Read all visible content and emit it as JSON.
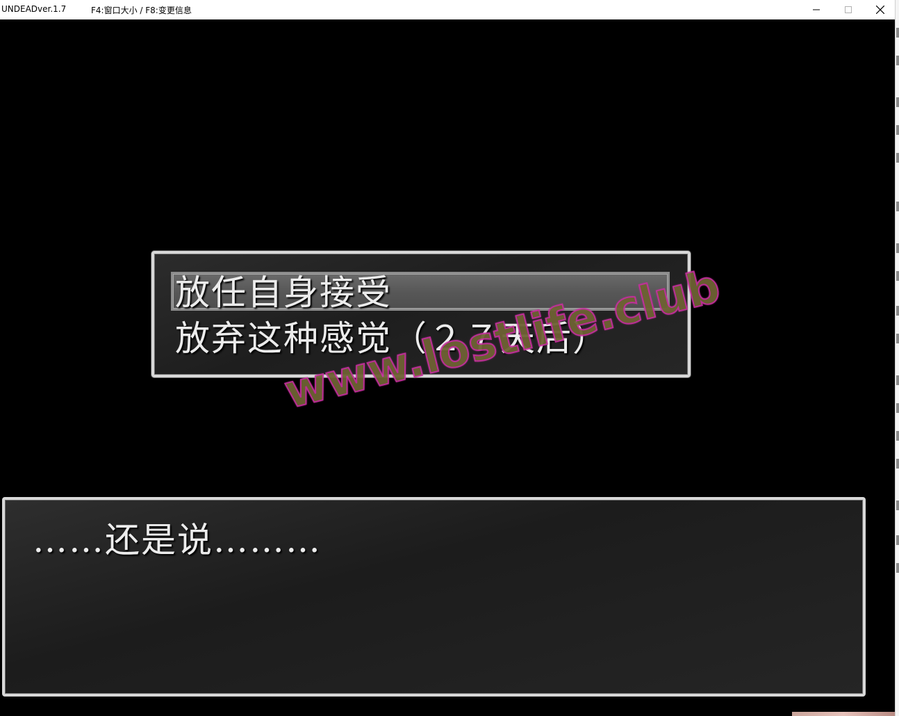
{
  "window": {
    "title": "UNDEADver.1.7",
    "info": "F4:窗口大小 / F8:变更信息",
    "buttons": [
      "minimize-icon",
      "maximize-icon",
      "close-icon"
    ]
  },
  "choices": {
    "items": [
      {
        "label": "放任自身接受",
        "selected": true
      },
      {
        "label": "放弃这种感觉（２７天后）",
        "selected": false
      }
    ]
  },
  "message": {
    "text": "……还是说………"
  },
  "watermark": {
    "text": "www.lostlife.club"
  },
  "colors": {
    "background": "#000000",
    "window_border": "#d8d8d8",
    "text": "#ececec",
    "cursor": "#5e5e5e"
  }
}
